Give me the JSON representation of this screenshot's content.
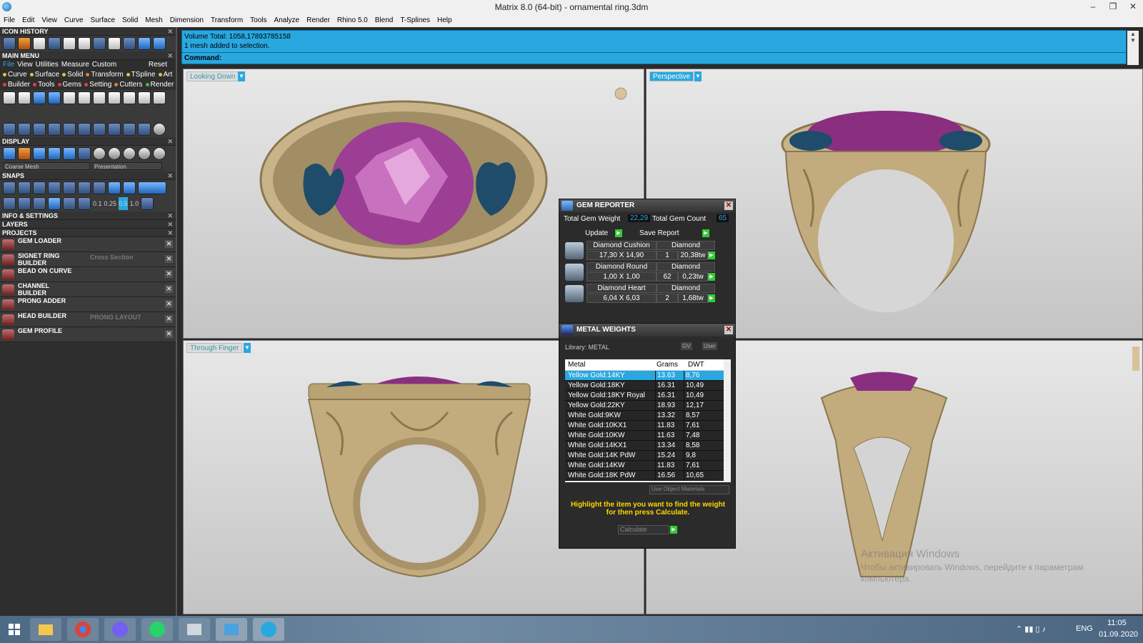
{
  "window": {
    "title": "Matrix 8.0 (64-bit) - ornamental ring.3dm",
    "minimize": "–",
    "restore": "❐",
    "close": "✕"
  },
  "menu": [
    "File",
    "Edit",
    "View",
    "Curve",
    "Surface",
    "Solid",
    "Mesh",
    "Dimension",
    "Transform",
    "Tools",
    "Analyze",
    "Render",
    "Rhino 5.0",
    "Blend",
    "T-Splines",
    "Help"
  ],
  "left": {
    "icon_history": "ICON HISTORY",
    "main_menu": "MAIN MENU",
    "mm_tabs": [
      "File",
      "View",
      "Utilities",
      "Measure",
      "Custom",
      "Reset"
    ],
    "mm_row1": [
      "Curve",
      "Surface",
      "Solid",
      "Transform",
      "TSpline",
      "Art"
    ],
    "mm_row2": [
      "Builder",
      "Tools",
      "Gems",
      "Setting",
      "Cutters",
      "Render"
    ],
    "display": "DISPLAY",
    "display_combo1": "Coarse Mesh",
    "display_combo2": "Presentation",
    "snaps": "SNAPS",
    "snap_vals": [
      "0.1",
      "0.25",
      "0.5",
      "1.0"
    ],
    "info": "INFO & SETTINGS",
    "layers": "LAYERS",
    "projects": "PROJECTS",
    "project_items": [
      {
        "l1": "GEM LOADER",
        "l2": "",
        "sub": ""
      },
      {
        "l1": "SIGNET RING",
        "l2": "BUILDER",
        "sub": "Cross Section"
      },
      {
        "l1": "BEAD ON CURVE",
        "l2": "",
        "sub": ""
      },
      {
        "l1": "CHANNEL",
        "l2": "BUILDER",
        "sub": ""
      },
      {
        "l1": "PRONG ADDER",
        "l2": "",
        "sub": ""
      },
      {
        "l1": "HEAD  BUILDER",
        "l2": "",
        "sub": "PRONG LAYOUT"
      },
      {
        "l1": "GEM PROFILE",
        "l2": "",
        "sub": ""
      }
    ]
  },
  "cmd": {
    "line1": "Volume Total: 1058,17893785158",
    "line2": "1 mesh added to selection.",
    "prompt": "Command:"
  },
  "viewports": {
    "tl": "Looking Down",
    "tr": "Perspective",
    "bl": "Through Finger",
    "br": ""
  },
  "gem_reporter": {
    "title": "GEM REPORTER",
    "total_weight_label": "Total Gem Weight",
    "total_weight": "22,29",
    "total_count_label": "Total Gem Count",
    "total_count": "65",
    "update": "Update",
    "save": "Save Report",
    "gems": [
      {
        "name": "Diamond Cushion",
        "type": "Diamond",
        "size": "17,30 X 14,90",
        "qty": "1",
        "weight": "20,38tw"
      },
      {
        "name": "Diamond Round",
        "type": "Diamond",
        "size": "1,00 X 1,00",
        "qty": "62",
        "weight": "0,23tw"
      },
      {
        "name": "Diamond Heart",
        "type": "Diamond",
        "size": "6,04 X 6,03",
        "qty": "2",
        "weight": "1,68tw"
      }
    ]
  },
  "metal_weights": {
    "title": "METAL WEIGHTS",
    "library": "Library: METAL",
    "gv": "GV",
    "user": "User",
    "cols": [
      "Metal",
      "Grams",
      "DWT"
    ],
    "rows": [
      [
        "Yellow Gold:14KY",
        "13.63",
        "8,76"
      ],
      [
        "Yellow Gold:18KY",
        "16.31",
        "10,49"
      ],
      [
        "Yellow Gold:18KY Royal",
        "16.31",
        "10,49"
      ],
      [
        "Yellow Gold:22KY",
        "18.93",
        "12,17"
      ],
      [
        "White Gold:9KW",
        "13.32",
        "8,57"
      ],
      [
        "White Gold:10KX1",
        "11.83",
        "7,61"
      ],
      [
        "White Gold:10KW",
        "11.63",
        "7,48"
      ],
      [
        "White Gold:14KX1",
        "13.34",
        "8,58"
      ],
      [
        "White Gold:14K PdW",
        "15.24",
        "9,8"
      ],
      [
        "White Gold:14KW",
        "11.83",
        "7,61"
      ],
      [
        "White Gold:18K PdW",
        "16.56",
        "10,65"
      ]
    ],
    "use_obj": "Use Object Materials",
    "hint": "Highlight the item you want to find the weight for then press Calculate.",
    "calculate": "Calculate"
  },
  "watermark": {
    "l1": "Активация Windows",
    "l2": "Чтобы активировать Windows, перейдите к параметрам",
    "l3": "компьютера."
  },
  "tray": {
    "lang": "ENG",
    "time": "11:05",
    "date": "01.09.2020"
  },
  "colors": {
    "accent": "#29a8e0",
    "panel": "#2b2b2b",
    "gold": "#c9b48a",
    "gem": "#b25aa8",
    "blue_gem": "#1f4c6a"
  }
}
